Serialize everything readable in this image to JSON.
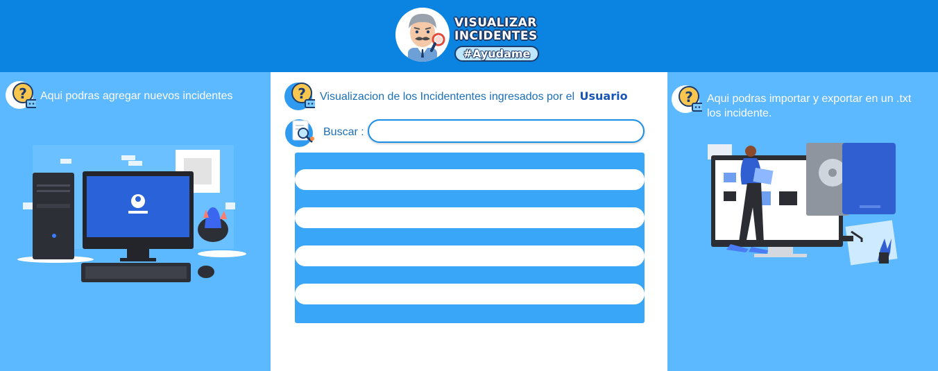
{
  "header": {
    "logo_line1": "VISUALIZAR",
    "logo_line2": "INCIDENTES",
    "logo_tag": "#Ayudame",
    "logo_icon": "detective-avatar-icon"
  },
  "left_panel": {
    "icon": "question-chat-icon",
    "text": "Aqui podras agregar nuevos incidentes",
    "illustration": "desktop-computer-illustration"
  },
  "center_panel": {
    "icon": "question-chat-icon",
    "title": "Visualizacion de los Incidententes ingresados por el",
    "title_emphasis": "Usuario",
    "search_icon": "document-search-icon",
    "search_label": "Buscar :",
    "search_value": "",
    "list_rows": [
      "",
      "",
      "",
      ""
    ]
  },
  "right_panel": {
    "icon": "question-chat-icon",
    "text_line1": "Aqui podras importar  y exportar en un .txt",
    "text_line2": "los incidente.",
    "illustration": "file-transfer-illustration"
  },
  "colors": {
    "header_bg": "#0a84e0",
    "side_panel_bg": "#5cb8ff",
    "list_bg": "#3aa6f8",
    "accent_text": "#1a6fb6"
  }
}
